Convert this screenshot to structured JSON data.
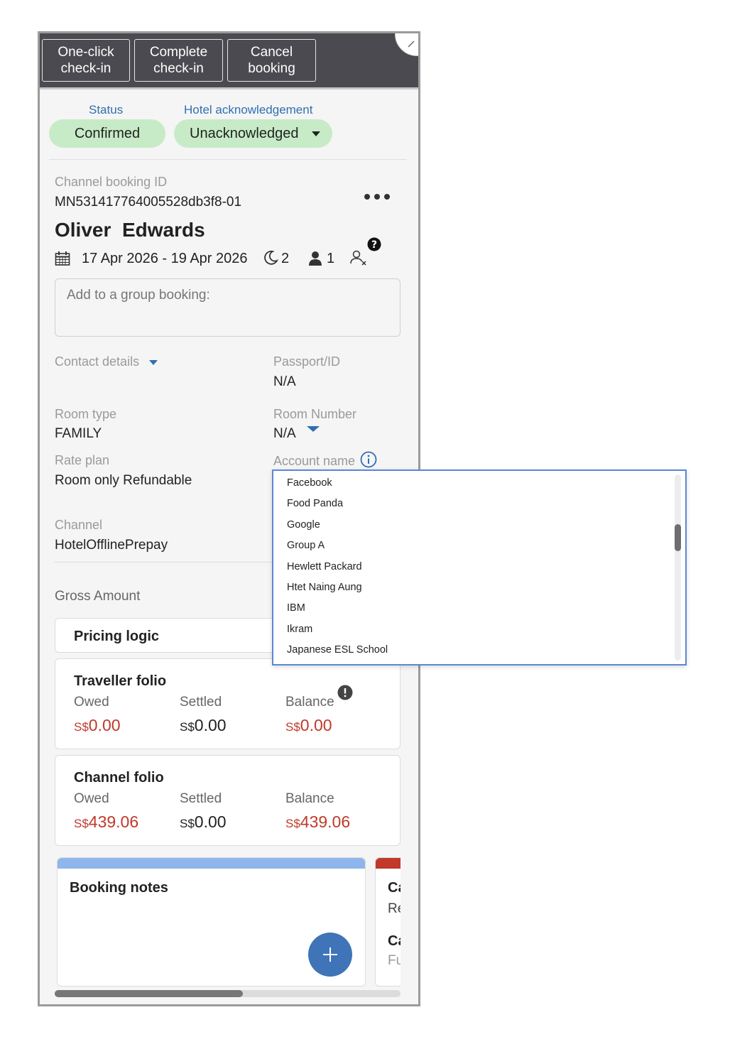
{
  "actions": {
    "one_click": "One-click check-in",
    "complete": "Complete check-in",
    "cancel": "Cancel booking"
  },
  "status": {
    "status_label": "Status",
    "status_value": "Confirmed",
    "ack_label": "Hotel acknowledgement",
    "ack_value": "Unacknowledged"
  },
  "booking": {
    "channel_id_label": "Channel booking ID",
    "channel_id": "MN531417764005528db3f8-01",
    "guest_name": "Oliver  Edwards",
    "dates": "17 Apr 2026 - 19 Apr 2026",
    "nights": "2",
    "guests": "1",
    "group_placeholder": "Add to a group booking:"
  },
  "details": {
    "contact_label": "Contact details",
    "passport_label": "Passport/ID",
    "passport_value": "N/A",
    "room_type_label": "Room type",
    "room_type_value": "FAMILY",
    "room_number_label": "Room Number",
    "room_number_value": "N/A",
    "rate_plan_label": "Rate plan",
    "rate_plan_value": "Room only Refundable",
    "account_label": "Account name",
    "channel_label": "Channel",
    "channel_value": "HotelOfflinePrepay",
    "gross_label": "Gross Amount"
  },
  "pricing": {
    "title": "Pricing logic"
  },
  "traveller_folio": {
    "title": "Traveller folio",
    "owed_label": "Owed",
    "settled_label": "Settled",
    "balance_label": "Balance",
    "currency": "S$",
    "owed": "0.00",
    "settled": "0.00",
    "balance": "0.00"
  },
  "channel_folio": {
    "title": "Channel folio",
    "owed_label": "Owed",
    "settled_label": "Settled",
    "balance_label": "Balance",
    "currency": "S$",
    "owed": "439.06",
    "settled": "0.00",
    "balance": "439.06"
  },
  "notes": {
    "title": "Booking notes",
    "partial_title_1": "Ca",
    "partial_text_1": "Re",
    "partial_title_2": "Ca",
    "partial_text_2": "Fu"
  },
  "account_options": [
    "Facebook",
    "Food Panda",
    "Google",
    "Group A",
    "Hewlett Packard",
    "Htet Naing Aung",
    "IBM",
    "Ikram",
    "Japanese ESL School"
  ],
  "colors": {
    "accent_blue": "#2f6fb0",
    "pill_green": "#c7ebc7",
    "amount_red": "#c0392b",
    "topbar": "#4a4a50",
    "notes_bar": "#8fb6ec",
    "fab": "#3f74b8"
  },
  "icons": [
    "calendar-icon",
    "moon-icon",
    "person-icon",
    "person-remove-icon",
    "help-icon",
    "more-icon",
    "info-icon",
    "alert-icon",
    "plus-icon",
    "caret-down-icon"
  ]
}
